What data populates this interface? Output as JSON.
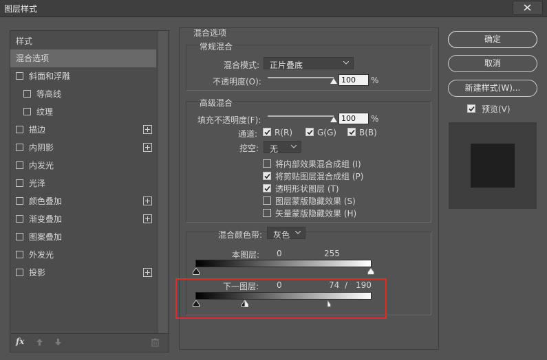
{
  "window": {
    "title": "图层样式"
  },
  "left": {
    "header": "样式",
    "items": [
      {
        "label": "混合选项",
        "checkbox": false,
        "indent": false,
        "selected": true,
        "plus": false
      },
      {
        "label": "斜面和浮雕",
        "checkbox": true,
        "indent": false,
        "selected": false,
        "plus": false
      },
      {
        "label": "等高线",
        "checkbox": true,
        "indent": true,
        "selected": false,
        "plus": false
      },
      {
        "label": "纹理",
        "checkbox": true,
        "indent": true,
        "selected": false,
        "plus": false
      },
      {
        "label": "描边",
        "checkbox": true,
        "indent": false,
        "selected": false,
        "plus": true
      },
      {
        "label": "内阴影",
        "checkbox": true,
        "indent": false,
        "selected": false,
        "plus": true
      },
      {
        "label": "内发光",
        "checkbox": true,
        "indent": false,
        "selected": false,
        "plus": false
      },
      {
        "label": "光泽",
        "checkbox": true,
        "indent": false,
        "selected": false,
        "plus": false
      },
      {
        "label": "颜色叠加",
        "checkbox": true,
        "indent": false,
        "selected": false,
        "plus": true
      },
      {
        "label": "渐变叠加",
        "checkbox": true,
        "indent": false,
        "selected": false,
        "plus": true
      },
      {
        "label": "图案叠加",
        "checkbox": true,
        "indent": false,
        "selected": false,
        "plus": false
      },
      {
        "label": "外发光",
        "checkbox": true,
        "indent": false,
        "selected": false,
        "plus": false
      },
      {
        "label": "投影",
        "checkbox": true,
        "indent": false,
        "selected": false,
        "plus": true
      }
    ],
    "footer_fx": "fx"
  },
  "blend": {
    "section_title": "混合选项",
    "general": {
      "title": "常规混合",
      "mode_label": "混合模式:",
      "mode_value": "正片叠底",
      "opacity_label": "不透明度(O):",
      "opacity_value": "100",
      "opacity_unit": "%",
      "opacity_fraction": 1.0
    },
    "advanced": {
      "title": "高级混合",
      "fill_label": "填充不透明度(F):",
      "fill_value": "100",
      "fill_unit": "%",
      "fill_fraction": 1.0,
      "channels_label": "通道:",
      "channel_r": "R(R)",
      "channel_g": "G(G)",
      "channel_b": "B(B)",
      "knockout_label": "挖空:",
      "knockout_value": "无",
      "options": [
        {
          "label": "将内部效果混合成组 (I)",
          "checked": false
        },
        {
          "label": "将剪贴图层混合成组 (P)",
          "checked": true
        },
        {
          "label": "透明形状图层 (T)",
          "checked": true
        },
        {
          "label": "图层蒙版隐藏效果 (S)",
          "checked": false
        },
        {
          "label": "矢量蒙版隐藏效果 (H)",
          "checked": false
        }
      ]
    },
    "blend_if": {
      "label": "混合颜色带:",
      "value": "灰色",
      "this_layer_label": "本图层:",
      "this_low": "0",
      "this_high": "255",
      "under_label": "下一图层:",
      "under_low": "0",
      "under_split_low": "74",
      "under_sep": "/",
      "under_high": "190"
    }
  },
  "buttons": {
    "ok": "确定",
    "cancel": "取消",
    "new_style": "新建样式(W)...",
    "preview_label": "预览(V)"
  },
  "colors": {
    "highlight_box": "#e02b2b"
  }
}
